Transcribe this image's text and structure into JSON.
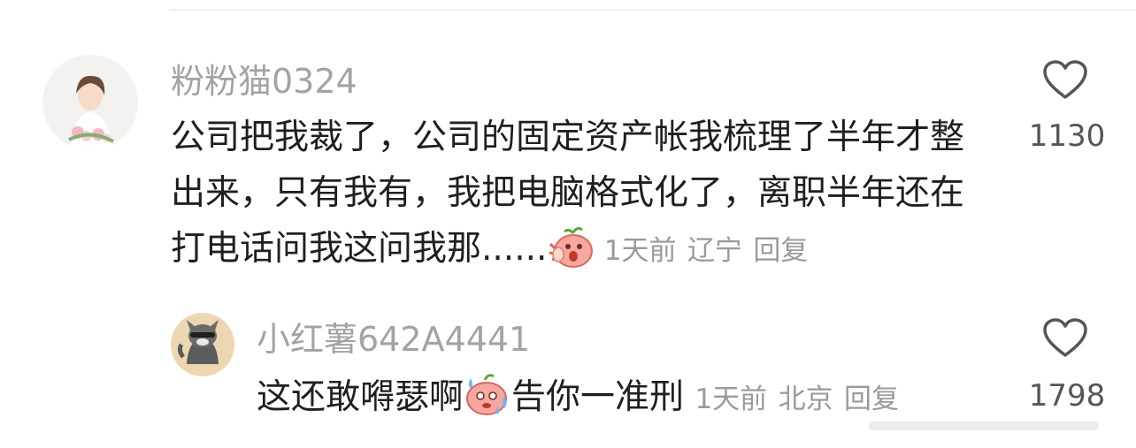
{
  "comments": [
    {
      "username": "粉粉猫0324",
      "text": "公司把我裁了，公司的固定资产帐我梳理了半年才整出来，只有我有，我把电脑格式化了，离职半年还在打电话问我这问我那......",
      "time": "1天前",
      "location": "辽宁",
      "reply_label": "回复",
      "likes": "1130"
    },
    {
      "username": "小红薯642A4441",
      "text_before": "这还敢嘚瑟啊",
      "text_after": "告你一准刑",
      "time": "1天前",
      "location": "北京",
      "reply_label": "回复",
      "likes": "1798"
    }
  ],
  "colors": {
    "username": "#a3a3a3",
    "meta": "#9a9a9a",
    "text": "#1f1f1f"
  },
  "icons": [
    "heart-outline-icon",
    "shocked-face-emoji",
    "sweat-face-emoji"
  ]
}
